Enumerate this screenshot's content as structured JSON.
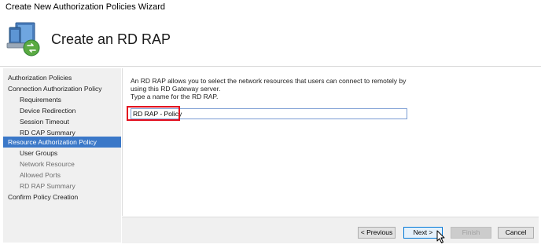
{
  "window": {
    "title": "Create New Authorization Policies Wizard"
  },
  "header": {
    "title": "Create an RD RAP",
    "icon": "computer-connection-icon"
  },
  "nav": {
    "items": [
      {
        "label": "Authorization Policies",
        "level": "top",
        "state": "normal"
      },
      {
        "label": "Connection Authorization Policy",
        "level": "top",
        "state": "normal"
      },
      {
        "label": "Requirements",
        "level": "sub",
        "state": "normal"
      },
      {
        "label": "Device Redirection",
        "level": "sub",
        "state": "normal"
      },
      {
        "label": "Session Timeout",
        "level": "sub",
        "state": "normal"
      },
      {
        "label": "RD CAP Summary",
        "level": "sub",
        "state": "normal"
      },
      {
        "label": "Resource Authorization Policy",
        "level": "top",
        "state": "selected"
      },
      {
        "label": "User Groups",
        "level": "sub",
        "state": "normal"
      },
      {
        "label": "Network Resource",
        "level": "sub",
        "state": "disabled"
      },
      {
        "label": "Allowed Ports",
        "level": "sub",
        "state": "disabled"
      },
      {
        "label": "RD RAP Summary",
        "level": "sub",
        "state": "disabled"
      },
      {
        "label": "Confirm Policy Creation",
        "level": "top",
        "state": "normal"
      }
    ]
  },
  "content": {
    "description_line1": "An RD RAP allows you to select the network resources that users can connect to remotely by",
    "description_line2": "using this RD Gateway server.",
    "prompt": "Type a name for the RD RAP.",
    "name_value": "RD RAP - Policy"
  },
  "buttons": {
    "previous": "< Previous",
    "next": "Next >",
    "finish": "Finish",
    "cancel": "Cancel"
  },
  "colors": {
    "selection": "#3b78c8",
    "highlight": "#e3101e",
    "input_border": "#7a9cd3"
  }
}
